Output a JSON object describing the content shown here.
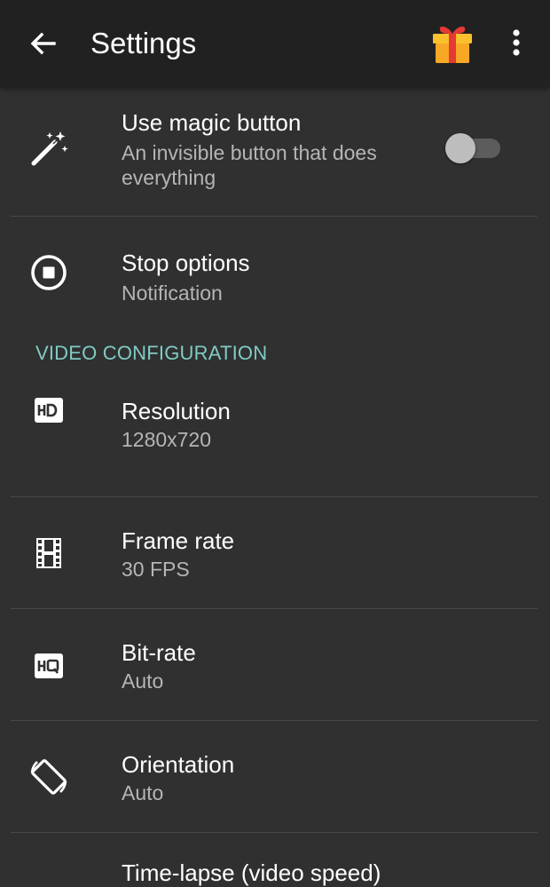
{
  "appbar": {
    "title": "Settings",
    "back_icon": "arrow-back-icon",
    "gift_icon": "gift-icon",
    "more_icon": "more-vert-icon"
  },
  "settings": {
    "magic": {
      "title": "Use magic button",
      "subtitle_line1": "An invisible button that does",
      "subtitle_line2": "everything",
      "icon": "magic-wand-icon",
      "toggle_on": false
    },
    "stop": {
      "title": "Stop options",
      "subtitle": "Notification",
      "icon": "stop-circle-icon"
    }
  },
  "video_section": {
    "header": "VIDEO CONFIGURATION",
    "items": [
      {
        "title": "Resolution",
        "subtitle": "1280x720",
        "icon": "hd-icon"
      },
      {
        "title": "Frame rate",
        "subtitle": "30 FPS",
        "icon": "film-icon"
      },
      {
        "title": "Bit-rate",
        "subtitle": "Auto",
        "icon": "hq-icon"
      },
      {
        "title": "Orientation",
        "subtitle": "Auto",
        "icon": "screen-rotation-icon"
      },
      {
        "title": "Time-lapse (video speed)"
      }
    ]
  },
  "colors": {
    "appbar_bg": "#212121",
    "background": "#303030",
    "section_header": "#80cbc4",
    "secondary_text": "#b5b5b5",
    "divider": "#484848"
  }
}
